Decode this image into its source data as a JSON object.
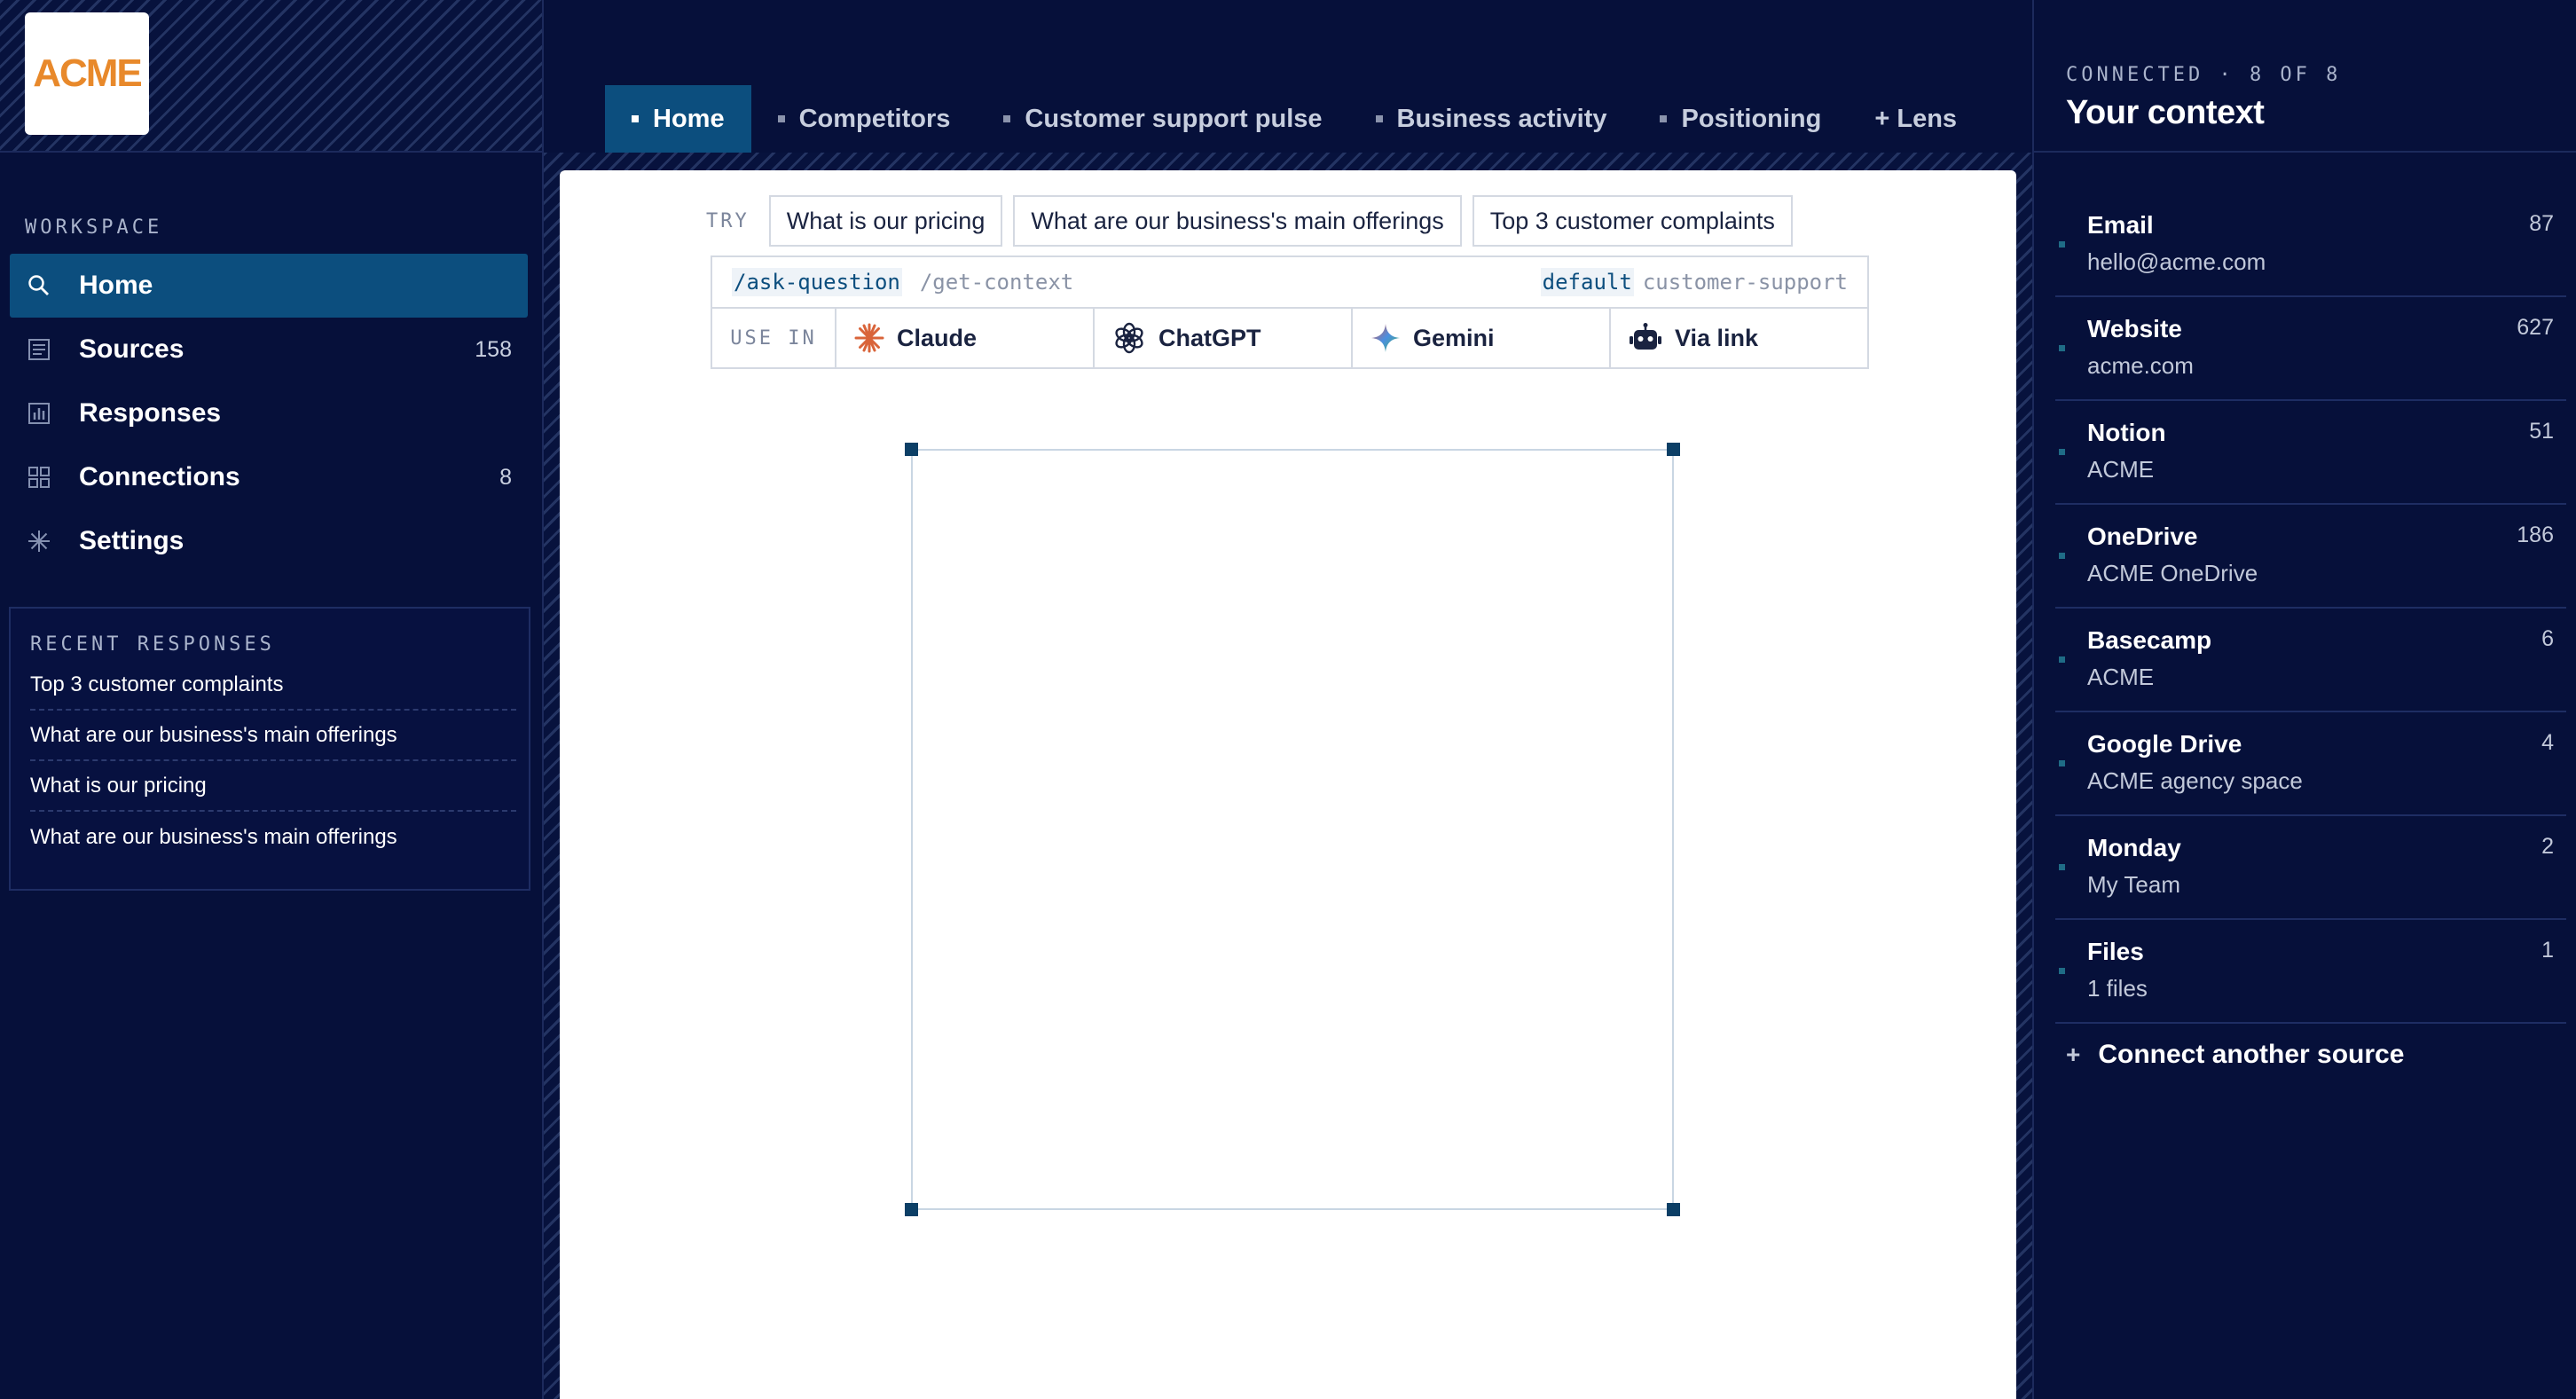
{
  "logo": {
    "text": "ACME"
  },
  "sidebar": {
    "workspace_label": "WORKSPACE",
    "items": [
      {
        "label": "Home",
        "count": "",
        "icon": "search-icon",
        "active": true
      },
      {
        "label": "Sources",
        "count": "158",
        "icon": "document-icon",
        "active": false
      },
      {
        "label": "Responses",
        "count": "",
        "icon": "bar-chart-icon",
        "active": false
      },
      {
        "label": "Connections",
        "count": "8",
        "icon": "grid-icon",
        "active": false
      },
      {
        "label": "Settings",
        "count": "",
        "icon": "asterisk-icon",
        "active": false
      }
    ],
    "recent": {
      "title": "RECENT RESPONSES",
      "items": [
        "Top 3 customer complaints",
        "What are our business's main offerings",
        "What is our pricing",
        "What are our business's main offerings"
      ]
    }
  },
  "tabs": [
    {
      "label": "Home",
      "active": true
    },
    {
      "label": "Competitors",
      "active": false
    },
    {
      "label": "Customer support pulse",
      "active": false
    },
    {
      "label": "Business activity",
      "active": false
    },
    {
      "label": "Positioning",
      "active": false
    },
    {
      "label": "+ Lens",
      "active": false
    }
  ],
  "main": {
    "try_label": "TRY",
    "suggestions": [
      "What is our pricing",
      "What are our business's main offerings",
      "Top 3 customer complaints"
    ],
    "commands": {
      "active": "/ask-question",
      "inactive": "/get-context",
      "default_label": "default",
      "profile": "customer-support"
    },
    "use_in": {
      "label": "USE IN",
      "targets": [
        {
          "label": "Claude",
          "icon": "claude-icon"
        },
        {
          "label": "ChatGPT",
          "icon": "chatgpt-icon"
        },
        {
          "label": "Gemini",
          "icon": "gemini-icon"
        },
        {
          "label": "Via link",
          "icon": "robot-icon"
        }
      ]
    }
  },
  "context": {
    "connected_label": "CONNECTED · 8 OF 8",
    "title": "Your context",
    "sources": [
      {
        "name": "Email",
        "sub": "hello@acme.com",
        "count": "87"
      },
      {
        "name": "Website",
        "sub": "acme.com",
        "count": "627"
      },
      {
        "name": "Notion",
        "sub": "ACME",
        "count": "51"
      },
      {
        "name": "OneDrive",
        "sub": "ACME OneDrive",
        "count": "186"
      },
      {
        "name": "Basecamp",
        "sub": "ACME",
        "count": "6"
      },
      {
        "name": "Google Drive",
        "sub": "ACME agency space",
        "count": "4"
      },
      {
        "name": "Monday",
        "sub": "My Team",
        "count": "2"
      },
      {
        "name": "Files",
        "sub": "1 files",
        "count": "1"
      }
    ],
    "connect_more": "Connect another source"
  },
  "colors": {
    "background": "#06103a",
    "accent": "#0c4e7e",
    "logo_orange": "#e8892b",
    "panel": "#ffffff"
  }
}
